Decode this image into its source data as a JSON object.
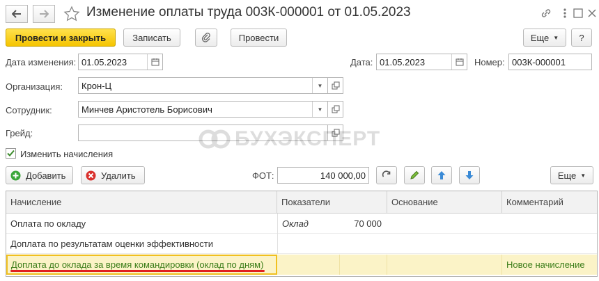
{
  "window": {
    "title": "Изменение оплаты труда 003К-000001 от 01.05.2023"
  },
  "toolbar": {
    "post_close_label": "Провести и закрыть",
    "save_label": "Записать",
    "post_label": "Провести",
    "more_label": "Еще",
    "help_label": "?"
  },
  "form": {
    "change_date_label": "Дата изменения:",
    "change_date_value": "01.05.2023",
    "date_label": "Дата:",
    "date_value": "01.05.2023",
    "number_label": "Номер:",
    "number_value": "003К-000001",
    "org_label": "Организация:",
    "org_value": "Крон-Ц",
    "employee_label": "Сотрудник:",
    "employee_value": "Минчев Аристотель Борисович",
    "grade_label": "Грейд:",
    "grade_value": "",
    "change_accruals_label": "Изменить начисления",
    "change_accruals_checked": true
  },
  "watermark": "БУХЭКСПЕРТ",
  "table_toolbar": {
    "add_label": "Добавить",
    "delete_label": "Удалить",
    "fot_label": "ФОТ:",
    "fot_value": "140 000,00",
    "more_label": "Еще"
  },
  "table": {
    "columns": [
      "Начисление",
      "Показатели",
      "Основание",
      "Комментарий"
    ],
    "rows": [
      {
        "accrual": "Оплата по окладу",
        "indicator": "Оклад",
        "indicator_value": "70 000",
        "basis": "",
        "comment": ""
      },
      {
        "accrual": "Доплата по результатам оценки эффективности",
        "indicator": "",
        "indicator_value": "",
        "basis": "",
        "comment": ""
      },
      {
        "accrual": "Доплата до оклада за время командировки (оклад по дням)",
        "indicator": "",
        "indicator_value": "",
        "basis": "",
        "comment": "Новое начисление"
      }
    ]
  },
  "colors": {
    "primary_button": "#f5c400",
    "selected_row": "#fbf3c7",
    "comment_text": "#3b7d19",
    "underline": "#e02020",
    "accent_blue": "#3a8ad6",
    "add_green": "#3aa63a",
    "delete_red": "#d9302c"
  }
}
